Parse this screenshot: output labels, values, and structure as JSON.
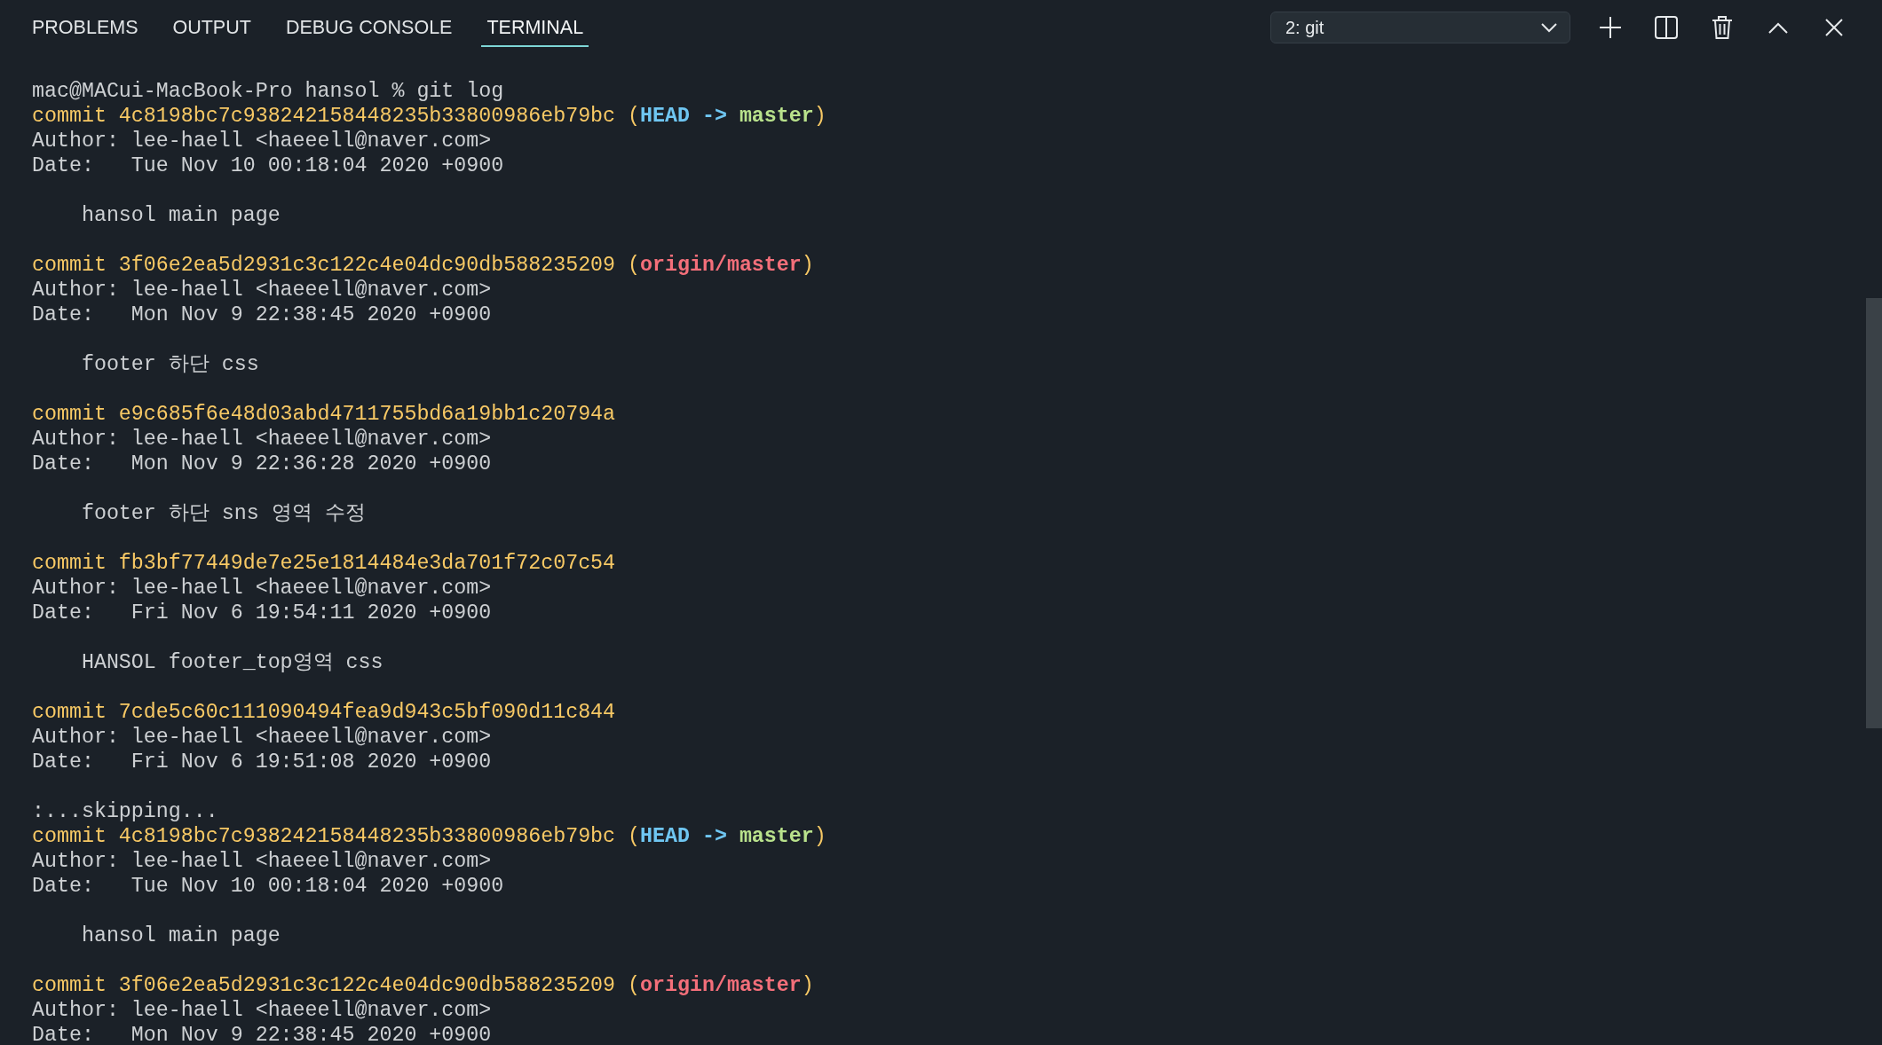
{
  "tabs": [
    {
      "label": "PROBLEMS",
      "selected": false
    },
    {
      "label": "OUTPUT",
      "selected": false
    },
    {
      "label": "DEBUG CONSOLE",
      "selected": false
    },
    {
      "label": "TERMINAL",
      "selected": true
    }
  ],
  "terminal_selector": {
    "value": "2: git"
  },
  "terminal_lines": [
    {
      "kind": "text",
      "segments": [
        {
          "kind": "plain",
          "text": "mac@MACui-MacBook-Pro hansol % git log"
        }
      ]
    },
    {
      "kind": "text",
      "segments": [
        {
          "kind": "hash",
          "text": "commit 4c8198bc7c938242158448235b33800986eb79bc ("
        },
        {
          "kind": "head",
          "text": "HEAD -> "
        },
        {
          "kind": "branch",
          "text": "master"
        },
        {
          "kind": "hash",
          "text": ")"
        }
      ]
    },
    {
      "kind": "text",
      "segments": [
        {
          "kind": "plain",
          "text": "Author: lee-haell <haeeell@naver.com>"
        }
      ]
    },
    {
      "kind": "text",
      "segments": [
        {
          "kind": "plain",
          "text": "Date:   Tue Nov 10 00:18:04 2020 +0900"
        }
      ]
    },
    {
      "kind": "blank"
    },
    {
      "kind": "text",
      "segments": [
        {
          "kind": "plain",
          "text": "    hansol main page"
        }
      ]
    },
    {
      "kind": "blank"
    },
    {
      "kind": "text",
      "segments": [
        {
          "kind": "hash",
          "text": "commit 3f06e2ea5d2931c3c122c4e04dc90db588235209 ("
        },
        {
          "kind": "remote",
          "text": "origin/master"
        },
        {
          "kind": "hash",
          "text": ")"
        }
      ]
    },
    {
      "kind": "text",
      "segments": [
        {
          "kind": "plain",
          "text": "Author: lee-haell <haeeell@naver.com>"
        }
      ]
    },
    {
      "kind": "text",
      "segments": [
        {
          "kind": "plain",
          "text": "Date:   Mon Nov 9 22:38:45 2020 +0900"
        }
      ]
    },
    {
      "kind": "blank"
    },
    {
      "kind": "text",
      "segments": [
        {
          "kind": "plain",
          "text": "    footer 하단 css"
        }
      ]
    },
    {
      "kind": "blank"
    },
    {
      "kind": "text",
      "segments": [
        {
          "kind": "hash",
          "text": "commit e9c685f6e48d03abd4711755bd6a19bb1c20794a"
        }
      ]
    },
    {
      "kind": "text",
      "segments": [
        {
          "kind": "plain",
          "text": "Author: lee-haell <haeeell@naver.com>"
        }
      ]
    },
    {
      "kind": "text",
      "segments": [
        {
          "kind": "plain",
          "text": "Date:   Mon Nov 9 22:36:28 2020 +0900"
        }
      ]
    },
    {
      "kind": "blank"
    },
    {
      "kind": "text",
      "segments": [
        {
          "kind": "plain",
          "text": "    footer 하단 sns 영역 수정"
        }
      ]
    },
    {
      "kind": "blank"
    },
    {
      "kind": "text",
      "segments": [
        {
          "kind": "hash",
          "text": "commit fb3bf77449de7e25e1814484e3da701f72c07c54"
        }
      ]
    },
    {
      "kind": "text",
      "segments": [
        {
          "kind": "plain",
          "text": "Author: lee-haell <haeeell@naver.com>"
        }
      ]
    },
    {
      "kind": "text",
      "segments": [
        {
          "kind": "plain",
          "text": "Date:   Fri Nov 6 19:54:11 2020 +0900"
        }
      ]
    },
    {
      "kind": "blank"
    },
    {
      "kind": "text",
      "segments": [
        {
          "kind": "plain",
          "text": "    HANSOL footer_top영역 css"
        }
      ]
    },
    {
      "kind": "blank"
    },
    {
      "kind": "text",
      "segments": [
        {
          "kind": "hash",
          "text": "commit 7cde5c60c111090494fea9d943c5bf090d11c844"
        }
      ]
    },
    {
      "kind": "text",
      "segments": [
        {
          "kind": "plain",
          "text": "Author: lee-haell <haeeell@naver.com>"
        }
      ]
    },
    {
      "kind": "text",
      "segments": [
        {
          "kind": "plain",
          "text": "Date:   Fri Nov 6 19:51:08 2020 +0900"
        }
      ]
    },
    {
      "kind": "blank"
    },
    {
      "kind": "text",
      "segments": [
        {
          "kind": "plain",
          "text": ":...skipping..."
        }
      ]
    },
    {
      "kind": "text",
      "segments": [
        {
          "kind": "hash",
          "text": "commit 4c8198bc7c938242158448235b33800986eb79bc ("
        },
        {
          "kind": "head",
          "text": "HEAD -> "
        },
        {
          "kind": "branch",
          "text": "master"
        },
        {
          "kind": "hash",
          "text": ")"
        }
      ]
    },
    {
      "kind": "text",
      "segments": [
        {
          "kind": "plain",
          "text": "Author: lee-haell <haeeell@naver.com>"
        }
      ]
    },
    {
      "kind": "text",
      "segments": [
        {
          "kind": "plain",
          "text": "Date:   Tue Nov 10 00:18:04 2020 +0900"
        }
      ]
    },
    {
      "kind": "blank"
    },
    {
      "kind": "text",
      "segments": [
        {
          "kind": "plain",
          "text": "    hansol main page"
        }
      ]
    },
    {
      "kind": "blank"
    },
    {
      "kind": "text",
      "segments": [
        {
          "kind": "hash",
          "text": "commit 3f06e2ea5d2931c3c122c4e04dc90db588235209 ("
        },
        {
          "kind": "remote",
          "text": "origin/master"
        },
        {
          "kind": "hash",
          "text": ")"
        }
      ]
    },
    {
      "kind": "text",
      "segments": [
        {
          "kind": "plain",
          "text": "Author: lee-haell <haeeell@naver.com>"
        }
      ]
    },
    {
      "kind": "text",
      "segments": [
        {
          "kind": "plain",
          "text": "Date:   Mon Nov 9 22:38:45 2020 +0900"
        }
      ]
    }
  ]
}
